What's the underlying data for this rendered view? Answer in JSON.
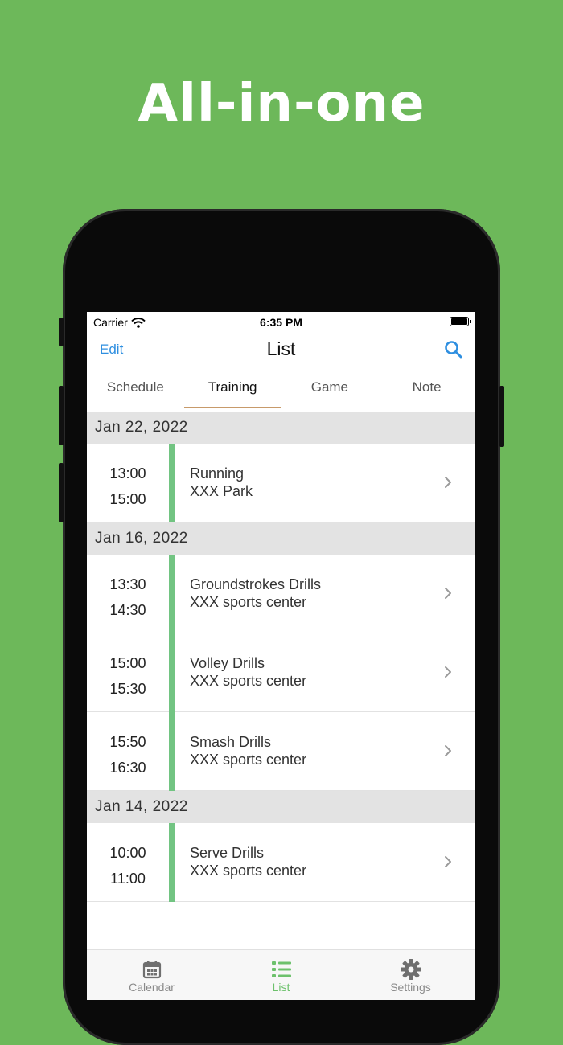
{
  "headline": "All-in-one",
  "status_bar": {
    "carrier": "Carrier",
    "time": "6:35 PM"
  },
  "navbar": {
    "edit_label": "Edit",
    "title": "List",
    "search_icon": "search-icon"
  },
  "tabs": [
    {
      "label": "Schedule",
      "active": false
    },
    {
      "label": "Training",
      "active": true
    },
    {
      "label": "Game",
      "active": false
    },
    {
      "label": "Note",
      "active": false
    }
  ],
  "sections": [
    {
      "date": "Jan 22, 2022",
      "entries": [
        {
          "start": "13:00",
          "end": "15:00",
          "title": "Running",
          "location": "XXX Park"
        }
      ]
    },
    {
      "date": "Jan 16, 2022",
      "entries": [
        {
          "start": "13:30",
          "end": "14:30",
          "title": "Groundstrokes Drills",
          "location": "XXX sports center"
        },
        {
          "start": "15:00",
          "end": "15:30",
          "title": "Volley Drills",
          "location": "XXX sports center"
        },
        {
          "start": "15:50",
          "end": "16:30",
          "title": "Smash Drills",
          "location": "XXX sports center"
        }
      ]
    },
    {
      "date": "Jan 14, 2022",
      "entries": [
        {
          "start": "10:00",
          "end": "11:00",
          "title": "Serve Drills",
          "location": "XXX sports center"
        }
      ]
    }
  ],
  "tab_bar": [
    {
      "label": "Calendar",
      "icon": "calendar-icon",
      "active": false
    },
    {
      "label": "List",
      "icon": "list-icon",
      "active": true
    },
    {
      "label": "Settings",
      "icon": "gear-icon",
      "active": false
    }
  ],
  "colors": {
    "background": "#6db85a",
    "accent_blue": "#2f8fe0",
    "entry_bar": "#72c482",
    "tab_indicator": "#c79a6a",
    "active_tab": "#6dc16c"
  }
}
